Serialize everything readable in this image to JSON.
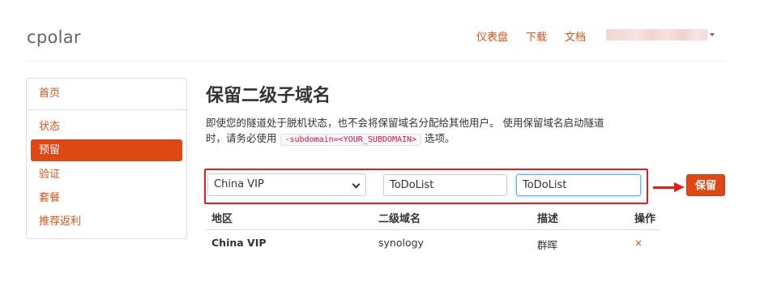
{
  "header": {
    "logo": "cpolar",
    "nav": [
      "仪表盘",
      "下载",
      "文档"
    ]
  },
  "sidebar": {
    "items": [
      {
        "label": "首页",
        "active": false
      },
      {
        "label": "状态",
        "active": false
      },
      {
        "label": "预留",
        "active": true
      },
      {
        "label": "验证",
        "active": false
      },
      {
        "label": "套餐",
        "active": false
      },
      {
        "label": "推荐返利",
        "active": false
      }
    ]
  },
  "main": {
    "title": "保留二级子域名",
    "desc_before": "即使您的隧道处于脱机状态，也不会将保留域名分配给其他用户。 使用保留域名启动隧道时，请务必使用",
    "desc_code": "-subdomain=<YOUR_SUBDOMAIN>",
    "desc_after": "选项。",
    "form": {
      "region_value": "China VIP",
      "subdomain_value": "ToDoList",
      "description_value": "ToDoList",
      "save_label": "保留"
    },
    "table": {
      "headers": [
        "地区",
        "二级域名",
        "描述",
        "操作"
      ],
      "rows": [
        {
          "region": "China VIP",
          "subdomain": "synology",
          "description": "群晖",
          "action": "×"
        }
      ]
    }
  },
  "colors": {
    "accent": "#dd4814",
    "link": "#d9541e",
    "annotation": "#e21e1e"
  }
}
